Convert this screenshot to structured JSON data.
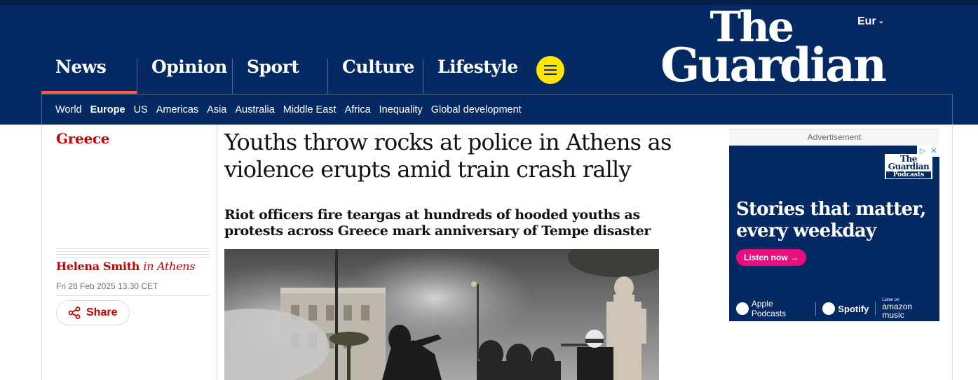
{
  "header": {
    "edition": "Eur",
    "logo": {
      "line1": "The",
      "line2": "Guardian"
    },
    "pillars": [
      {
        "label": "News",
        "active": true
      },
      {
        "label": "Opinion",
        "active": false
      },
      {
        "label": "Sport",
        "active": false
      },
      {
        "label": "Culture",
        "active": false
      },
      {
        "label": "Lifestyle",
        "active": false
      }
    ],
    "subnav": [
      "World",
      "Europe",
      "US",
      "Americas",
      "Asia",
      "Australia",
      "Middle East",
      "Africa",
      "Inequality",
      "Global development"
    ],
    "subnav_current": "Europe"
  },
  "article": {
    "section": "Greece",
    "headline": "Youths throw rocks at police in Athens as violence erupts amid train crash rally",
    "standfirst": "Riot officers fire teargas at hundreds of hooded youths as protests across Greece mark anniversary of Tempe disaster",
    "author": "Helena Smith",
    "author_location": "in Athens",
    "date": "Fri 28 Feb 2025 13.30 CET",
    "share_label": "Share"
  },
  "ad": {
    "label": "Advertisement",
    "brand": {
      "line1": "The",
      "line2": "Guardian",
      "line3": "Podcasts"
    },
    "headline": "Stories that matter, every weekday",
    "cta": "Listen now →",
    "platforms": {
      "apple": "Apple Podcasts",
      "spotify": "Spotify",
      "amazon_small": "Listen on",
      "amazon_big": "amazon music"
    }
  },
  "colors": {
    "brand_blue": "#052962",
    "news_red": "#c70000",
    "active_underline": "#ff5943",
    "menu_yellow": "#ffe500",
    "cta_pink": "#e5107e"
  }
}
